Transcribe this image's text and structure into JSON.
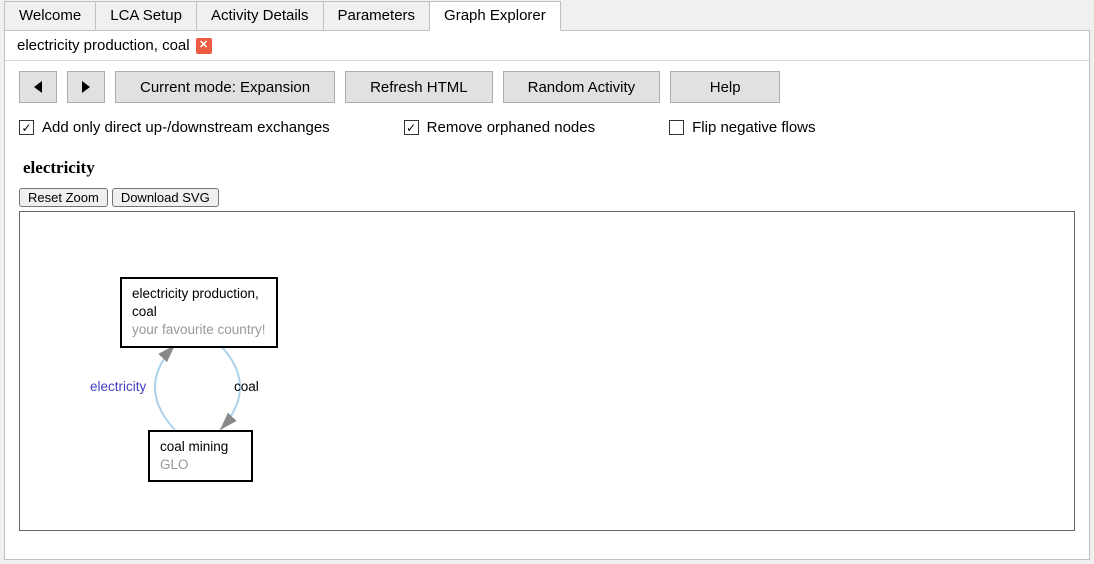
{
  "tabs": {
    "t0": "Welcome",
    "t1": "LCA Setup",
    "t2": "Activity Details",
    "t3": "Parameters",
    "t4": "Graph Explorer"
  },
  "sub_tab": {
    "label": "electricity production, coal"
  },
  "toolbar": {
    "mode": "Current mode: Expansion",
    "refresh": "Refresh HTML",
    "random": "Random Activity",
    "help": "Help"
  },
  "checks": {
    "direct": "Add only direct up-/downstream exchanges",
    "orphan": "Remove orphaned nodes",
    "flip": "Flip negative flows"
  },
  "graph": {
    "title": "electricity",
    "reset_zoom": "Reset Zoom",
    "download_svg": "Download SVG",
    "node1": {
      "line1": "electricity production,",
      "line2": "coal",
      "sub": "your favourite country!"
    },
    "node2": {
      "line1": "coal mining",
      "sub": "GLO"
    },
    "edge1": "electricity",
    "edge2": "coal",
    "edge1_color": "#4040c0",
    "edge2_color": "#000"
  }
}
